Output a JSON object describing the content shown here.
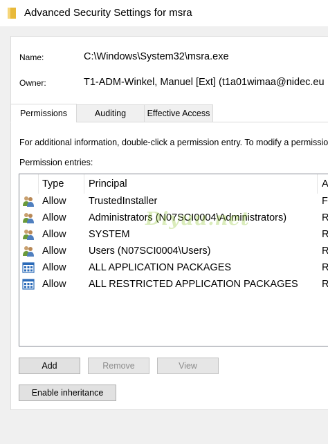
{
  "window": {
    "title": "Advanced Security Settings for msra"
  },
  "details": {
    "name_label": "Name:",
    "name_value": "C:\\Windows\\System32\\msra.exe",
    "owner_label": "Owner:",
    "owner_value": "T1-ADM-Winkel, Manuel [Ext] (t1a01wimaa@nidec.eu"
  },
  "tabs": [
    {
      "label": "Permissions",
      "active": true
    },
    {
      "label": "Auditing",
      "active": false
    },
    {
      "label": "Effective Access",
      "active": false
    }
  ],
  "info_text": "For additional information, double-click a permission entry. To modify a permission e",
  "entries_label": "Permission entries:",
  "columns": {
    "type": "Type",
    "principal": "Principal",
    "access": "A"
  },
  "entries": [
    {
      "icon": "users-icon",
      "type": "Allow",
      "principal": "TrustedInstaller",
      "access": "Fu"
    },
    {
      "icon": "users-icon",
      "type": "Allow",
      "principal": "Administrators (N07SCI0004\\Administrators)",
      "access": "Re"
    },
    {
      "icon": "users-icon",
      "type": "Allow",
      "principal": "SYSTEM",
      "access": "Re"
    },
    {
      "icon": "users-icon",
      "type": "Allow",
      "principal": "Users (N07SCI0004\\Users)",
      "access": "Re"
    },
    {
      "icon": "app-packages-icon",
      "type": "Allow",
      "principal": "ALL APPLICATION PACKAGES",
      "access": "Re"
    },
    {
      "icon": "app-packages-icon",
      "type": "Allow",
      "principal": "ALL RESTRICTED APPLICATION PACKAGES",
      "access": "Re"
    }
  ],
  "watermark": "Diyuu.net",
  "buttons": {
    "add": "Add",
    "remove": "Remove",
    "view": "View",
    "enable_inheritance": "Enable inheritance"
  }
}
